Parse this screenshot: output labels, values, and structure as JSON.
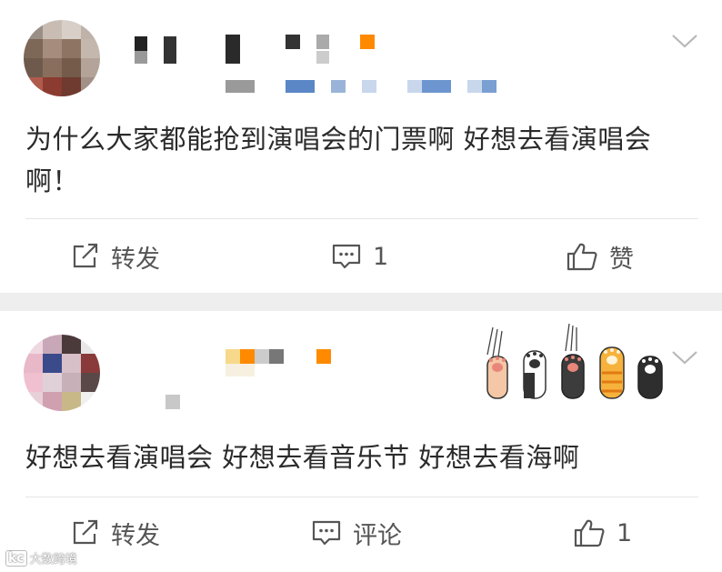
{
  "posts": [
    {
      "content": "为什么大家都能抢到演唱会的门票啊 好想去看演唱会啊！",
      "actions": {
        "repost_label": "转发",
        "comment_label": "1",
        "like_label": "赞"
      }
    },
    {
      "content": "好想去看演唱会  好想去看音乐节  好想去看海啊",
      "actions": {
        "repost_label": "转发",
        "comment_label": "评论",
        "like_label": "1"
      }
    }
  ],
  "watermark": {
    "logo": "kc",
    "text": "大数跨境"
  },
  "colors": {
    "text": "#2b2b2b",
    "action_text": "#555555",
    "divider": "#e6e6e6",
    "separator": "#eeeeee",
    "accent_orange": "#ff8a00"
  }
}
